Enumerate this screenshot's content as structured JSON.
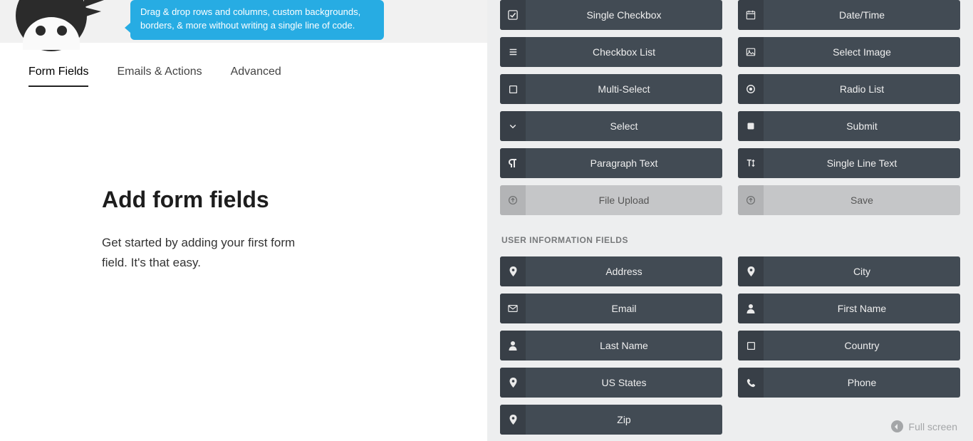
{
  "tooltip": "Drag & drop rows and columns, custom backgrounds, borders, & more without writing a single line of code.",
  "tabs": {
    "form_fields": "Form Fields",
    "emails_actions": "Emails & Actions",
    "advanced": "Advanced"
  },
  "main": {
    "heading": "Add form fields",
    "sub": "Get started by adding your first form field. It's that easy."
  },
  "common_fields": [
    {
      "icon": "check-square",
      "label": "Single Checkbox",
      "disabled": false
    },
    {
      "icon": "calendar",
      "label": "Date/Time",
      "disabled": false
    },
    {
      "icon": "list",
      "label": "Checkbox List",
      "disabled": false
    },
    {
      "icon": "image",
      "label": "Select Image",
      "disabled": false
    },
    {
      "icon": "square",
      "label": "Multi-Select",
      "disabled": false
    },
    {
      "icon": "record",
      "label": "Radio List",
      "disabled": false
    },
    {
      "icon": "chevron-down",
      "label": "Select",
      "disabled": false
    },
    {
      "icon": "square-solid",
      "label": "Submit",
      "disabled": false
    },
    {
      "icon": "paragraph",
      "label": "Paragraph Text",
      "disabled": false
    },
    {
      "icon": "text-height",
      "label": "Single Line Text",
      "disabled": false
    },
    {
      "icon": "upload",
      "label": "File Upload",
      "disabled": true
    },
    {
      "icon": "upload",
      "label": "Save",
      "disabled": true
    }
  ],
  "user_section_title": "USER INFORMATION FIELDS",
  "user_fields": [
    {
      "icon": "map-pin",
      "label": "Address"
    },
    {
      "icon": "map-pin",
      "label": "City"
    },
    {
      "icon": "envelope",
      "label": "Email"
    },
    {
      "icon": "user",
      "label": "First Name"
    },
    {
      "icon": "user",
      "label": "Last Name"
    },
    {
      "icon": "square",
      "label": "Country"
    },
    {
      "icon": "map-pin",
      "label": "US States"
    },
    {
      "icon": "phone",
      "label": "Phone"
    },
    {
      "icon": "map-pin",
      "label": "Zip"
    }
  ],
  "fullscreen_label": "Full screen"
}
